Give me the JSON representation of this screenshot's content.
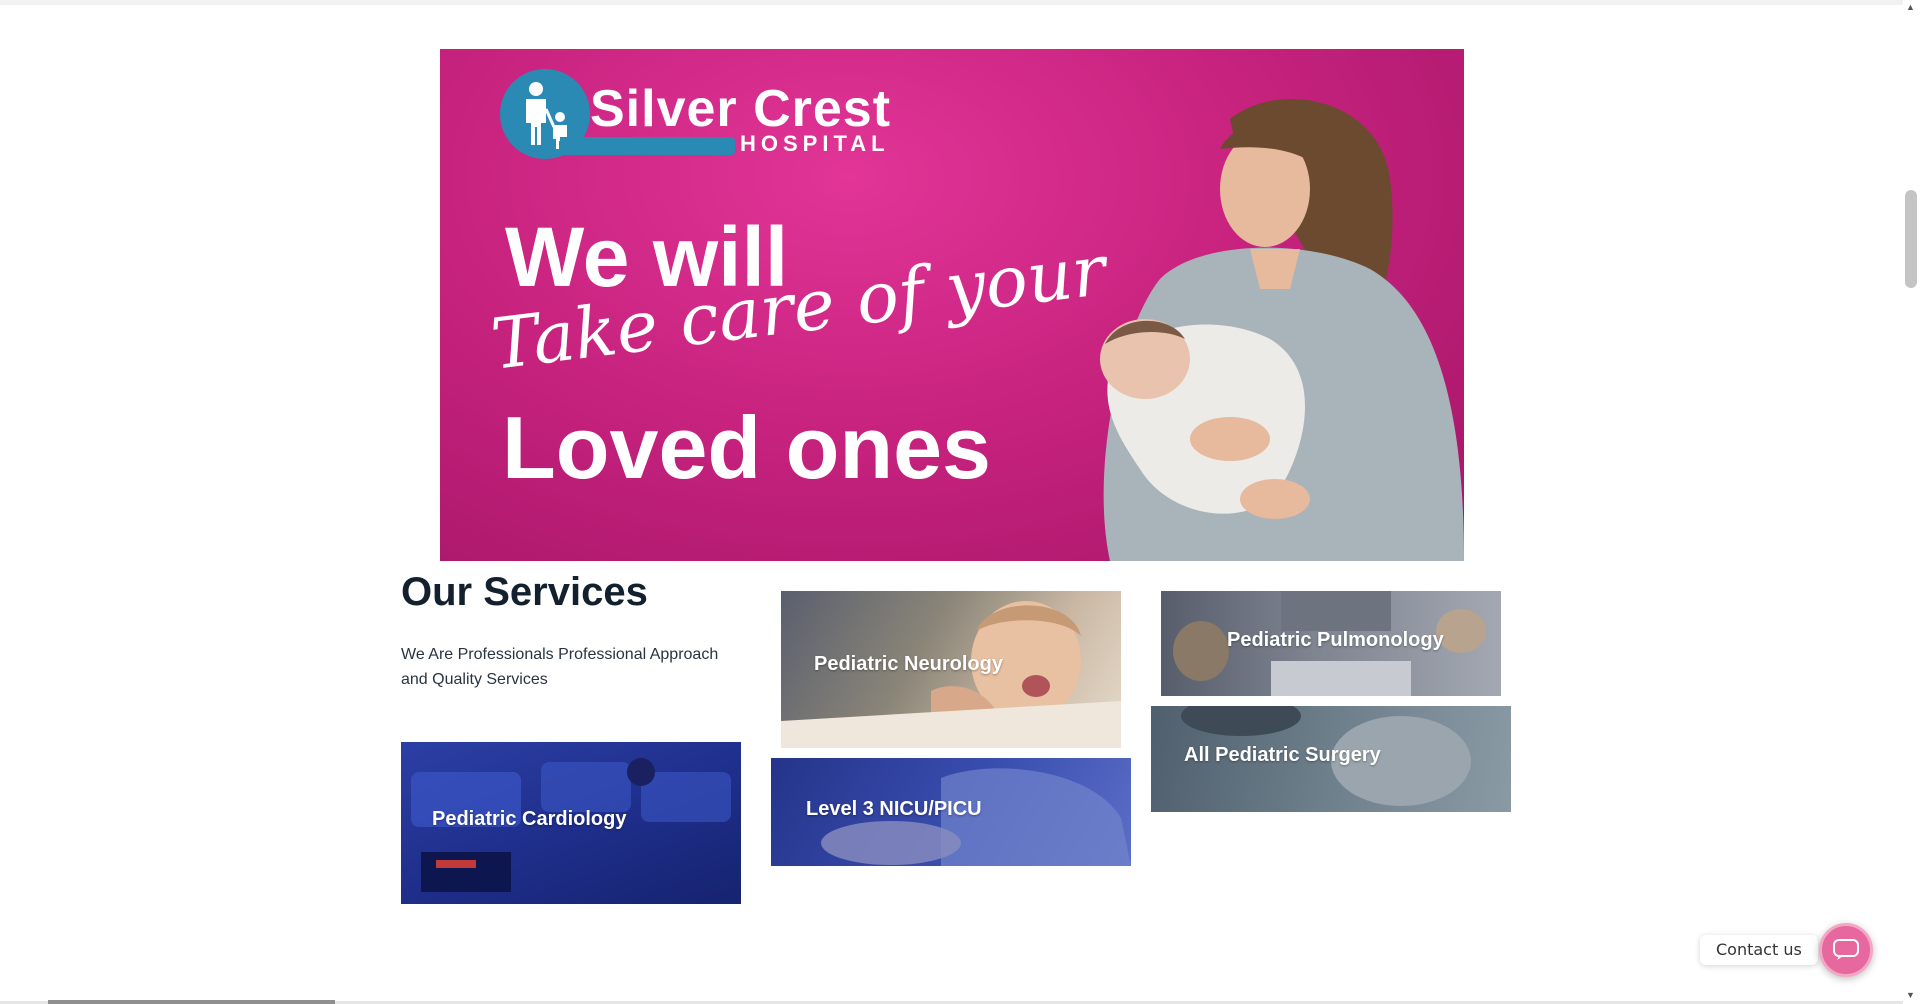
{
  "hero": {
    "logo_name": "Silver Crest",
    "logo_sub": "HOSPITAL",
    "line1": "We will",
    "line2": "Take care of your",
    "line3": "Loved ones"
  },
  "services": {
    "title": "Our Services",
    "subtitle": "We Are Professionals Professional Approach and Quality Services",
    "cards": [
      {
        "label": "Pediatric Neurology"
      },
      {
        "label": "Pediatric Pulmonology"
      },
      {
        "label": "All Pediatric Surgery"
      },
      {
        "label": "Pediatric Cardiology"
      },
      {
        "label": "Level 3 NICU/PICU"
      }
    ]
  },
  "contact": {
    "label": "Contact us",
    "icon": "chat-icon"
  },
  "colors": {
    "hero_bg": "#c8237f",
    "logo_blue": "#2a8ab4",
    "contact_pink": "#e6689e",
    "heading": "#13202e"
  }
}
